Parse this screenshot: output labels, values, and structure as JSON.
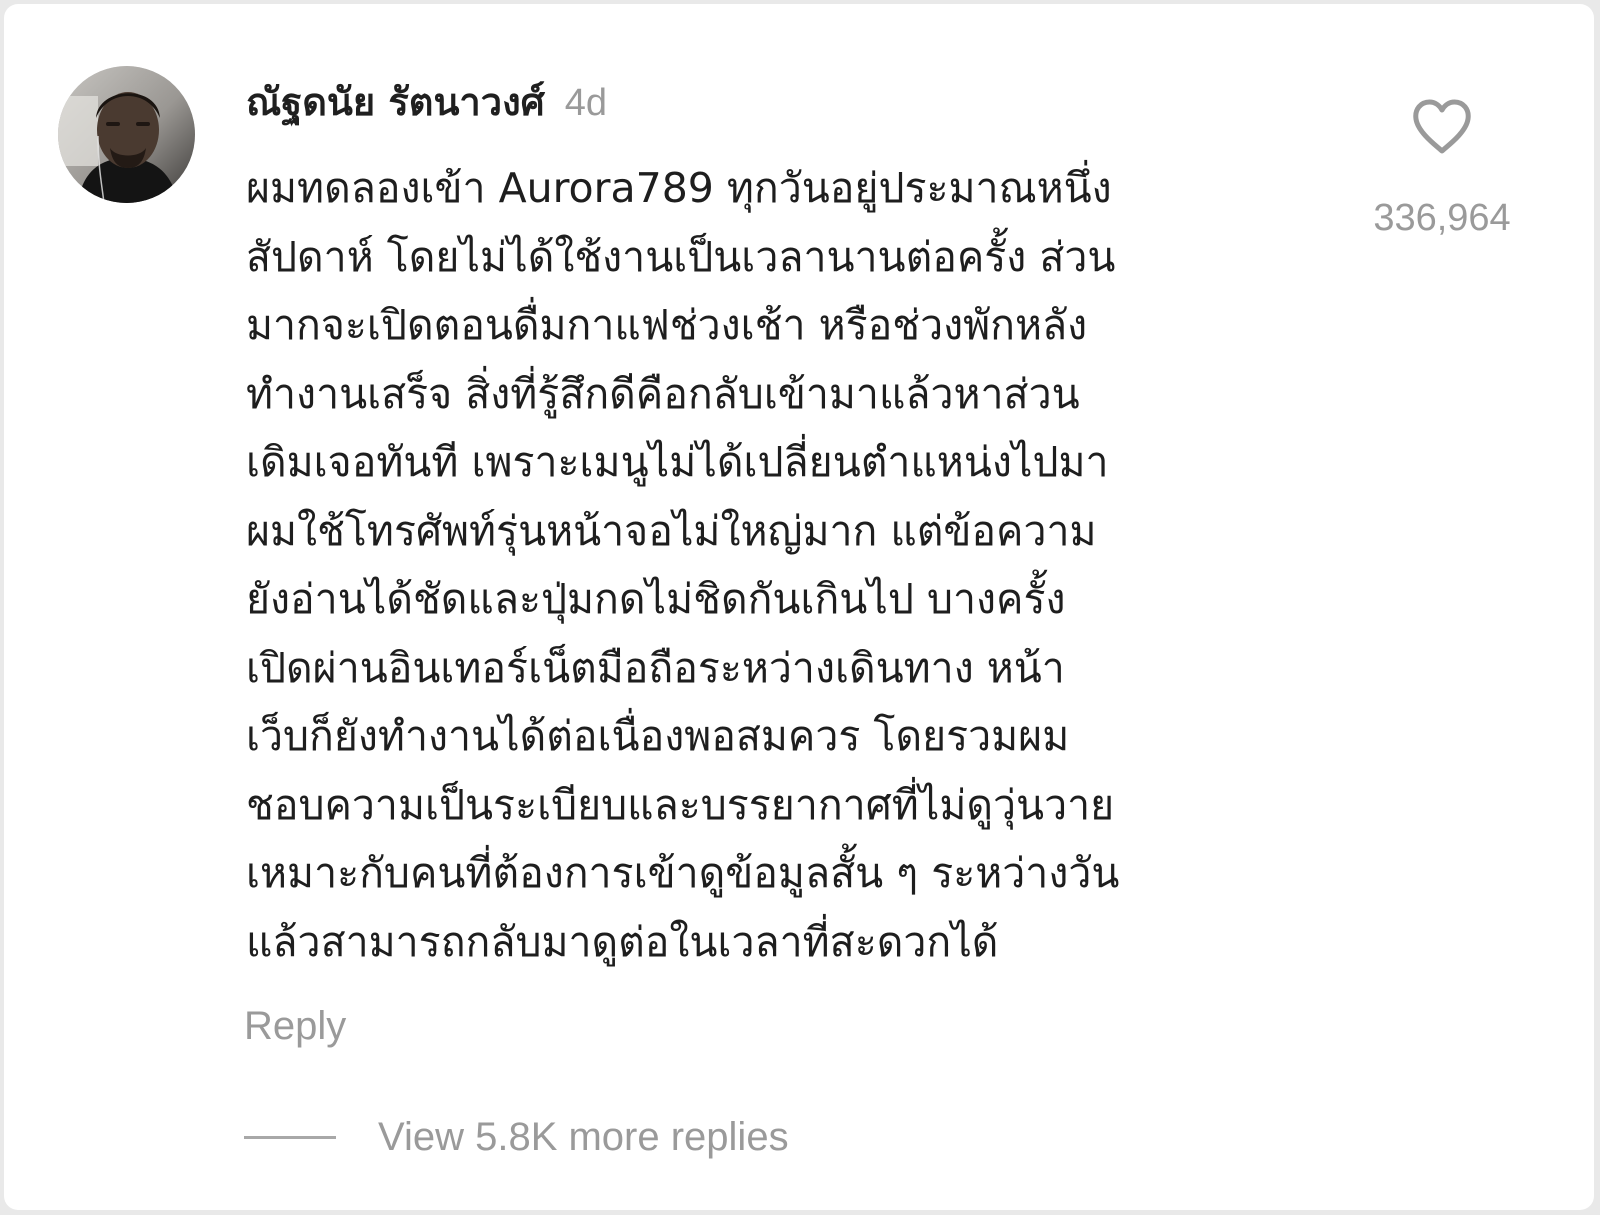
{
  "comment": {
    "author": {
      "name": "ณัฐดนัย รัตนาวงศ์",
      "avatar_icon": "user-avatar-photo"
    },
    "timestamp": "4d",
    "lines": [
      "ผมทดลองเข้า Aurora789 ทุกวันอยู่ประมาณหนึ่ง",
      "สัปดาห์ โดยไม่ได้ใช้งานเป็นเวลานานต่อครั้ง ส่วน",
      "มากจะเปิดตอนดื่มกาแฟช่วงเช้า หรือช่วงพักหลัง",
      "ทำงานเสร็จ สิ่งที่รู้สึกดีคือกลับเข้ามาแล้วหาส่วน",
      "เดิมเจอทันที เพราะเมนูไม่ได้เปลี่ยนตำแหน่งไปมา",
      "ผมใช้โทรศัพท์รุ่นหน้าจอไม่ใหญ่มาก แต่ข้อความ",
      "ยังอ่านได้ชัดและปุ่มกดไม่ชิดกันเกินไป บางครั้ง",
      "เปิดผ่านอินเทอร์เน็ตมือถือระหว่างเดินทาง หน้า",
      "เว็บก็ยังทำงานได้ต่อเนื่องพอสมควร โดยรวมผม",
      "ชอบความเป็นระเบียบและบรรยากาศที่ไม่ดูวุ่นวาย",
      "เหมาะกับคนที่ต้องการเข้าดูข้อมูลสั้น ๆ ระหว่างวัน",
      "แล้วสามารถกลับมาดูต่อในเวลาที่สะดวกได้"
    ],
    "like_icon": "heart-outline-icon",
    "like_count": "336,964",
    "reply_label": "Reply",
    "view_replies_label": "View 5.8K more replies"
  },
  "colors": {
    "background": "#e9e9e9",
    "card": "#ffffff",
    "text_primary": "#1e1e1e",
    "text_secondary": "#9a9a9a",
    "icon": "#9a9a9a"
  }
}
